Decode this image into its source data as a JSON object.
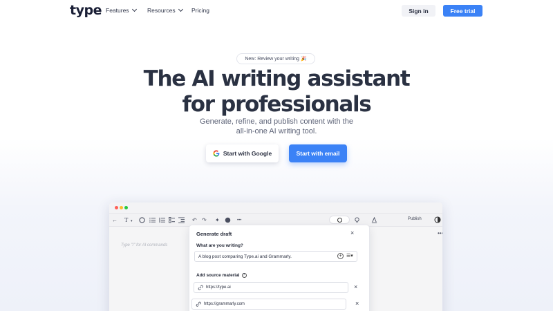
{
  "header": {
    "logo": "type",
    "nav": [
      {
        "label": "Features",
        "has_dropdown": true
      },
      {
        "label": "Resources",
        "has_dropdown": true
      },
      {
        "label": "Pricing",
        "has_dropdown": false
      }
    ],
    "signin_label": "Sign in",
    "trial_label": "Free trial"
  },
  "hero": {
    "badge": "New: Review your writing",
    "badge_emoji": "🎉",
    "title_line1": "The AI writing assistant",
    "title_line2": "for professionals",
    "subtitle_line1": "Generate, refine, and publish content with the",
    "subtitle_line2": "all-in-one AI writing tool.",
    "google_button": "Start with Google",
    "email_button": "Start with email"
  },
  "app": {
    "toolbar": {
      "back_icon": "←",
      "text_style_icon": "T",
      "undo_icon": "↶",
      "redo_icon": "↷",
      "more_icon": "•••",
      "publish_label": "Publish"
    },
    "editor_placeholder": "Type \"/\" for AI commands",
    "dialog": {
      "title": "Generate draft",
      "question": "What are you writing?",
      "input_value": "A blog post comparing Type.ai and Grammarly.",
      "source_label": "Add source material",
      "sources": [
        "https://type.ai",
        "https://grammarly.com"
      ]
    }
  },
  "colors": {
    "accent": "#3b82f6",
    "heading": "#2a3142",
    "window_red": "#ff5f57",
    "window_yellow": "#febc2e",
    "window_green": "#28c840"
  }
}
